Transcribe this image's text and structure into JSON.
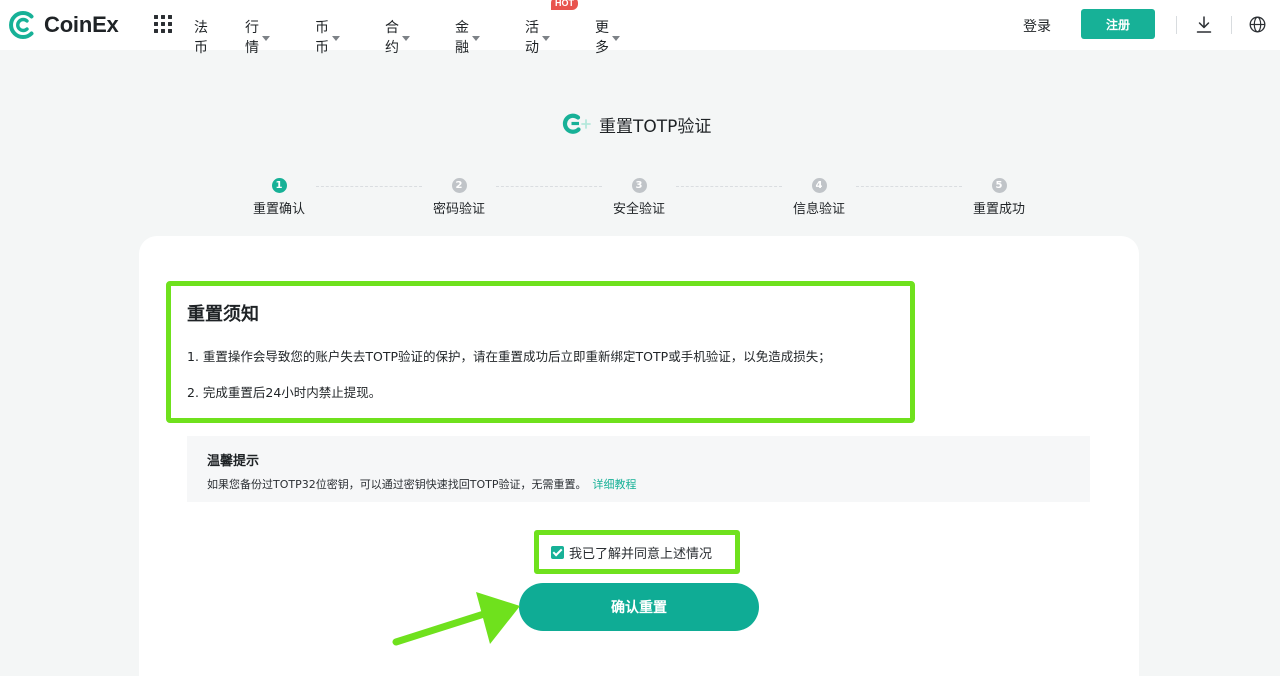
{
  "header": {
    "logo_text": "CoinEx",
    "nav": [
      {
        "label": "法币",
        "has_caret": false
      },
      {
        "label": "行情",
        "has_caret": true
      },
      {
        "label": "币币",
        "has_caret": true
      },
      {
        "label": "合约",
        "has_caret": true
      },
      {
        "label": "金融",
        "has_caret": true
      },
      {
        "label": "活动",
        "has_caret": true,
        "badge": "HOT"
      },
      {
        "label": "更多",
        "has_caret": true
      }
    ],
    "login_label": "登录",
    "register_label": "注册",
    "icons": [
      "apps-grid-icon",
      "download-icon",
      "globe-icon"
    ]
  },
  "page": {
    "title": "重置TOTP验证",
    "title_icon": "google-authenticator-icon"
  },
  "steps": [
    {
      "num": "1",
      "label": "重置确认",
      "active": true
    },
    {
      "num": "2",
      "label": "密码验证",
      "active": false
    },
    {
      "num": "3",
      "label": "安全验证",
      "active": false
    },
    {
      "num": "4",
      "label": "信息验证",
      "active": false
    },
    {
      "num": "5",
      "label": "重置成功",
      "active": false
    }
  ],
  "notice": {
    "title": "重置须知",
    "line1": "1. 重置操作会导致您的账户失去TOTP验证的保护，请在重置成功后立即重新绑定TOTP或手机验证，以免造成损失；",
    "line2": "2. 完成重置后24小时内禁止提现。"
  },
  "tips": {
    "title": "温馨提示",
    "text": "如果您备份过TOTP32位密钥，可以通过密钥快速找回TOTP验证，无需重置。",
    "link": "详细教程"
  },
  "agreement": {
    "label": "我已了解并同意上述情况",
    "checked": true
  },
  "confirm_label": "确认重置",
  "colors": {
    "brand": "#17b197",
    "button": "#0fac95",
    "highlight": "#6fe11d",
    "hot": "#e8544e"
  }
}
